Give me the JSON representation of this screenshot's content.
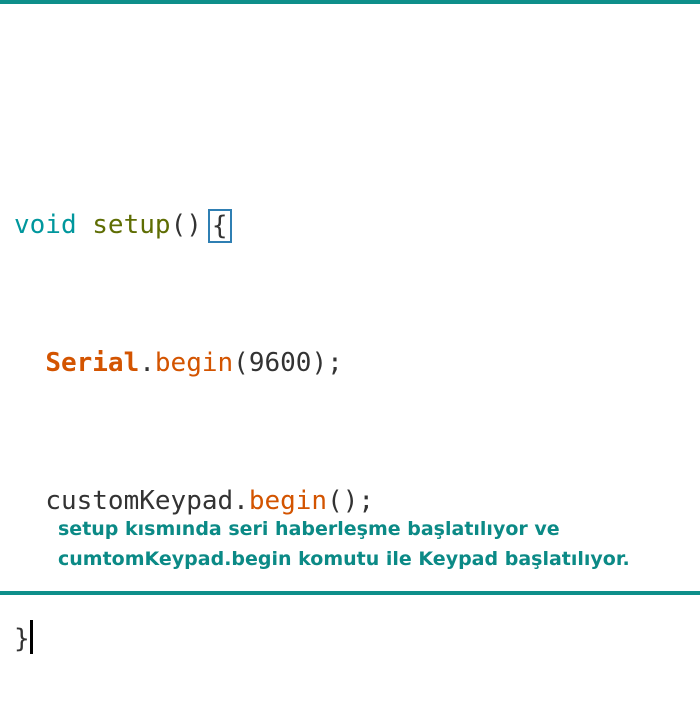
{
  "code": {
    "line1": {
      "type": "void",
      "fn": "setup",
      "parens": "()",
      "brace": "{"
    },
    "line2": {
      "class": "Serial",
      "dot": ".",
      "method": "begin",
      "args": "(9600);"
    },
    "line3": {
      "object": "customKeypad",
      "dot": ".",
      "method": "begin",
      "args": "();"
    },
    "line4": {
      "brace": "}"
    }
  },
  "caption": {
    "line1": "setup kısmında seri haberleşme başlatılıyor ve",
    "line2": "cumtomKeypad.begin komutu ile Keypad başlatılıyor."
  },
  "colors": {
    "accent": "#0e8f8a",
    "keyword_type": "#00979d",
    "function_name": "#5e6d03",
    "builtin_orange": "#d35400",
    "bracket_highlight": "#2f7fb3"
  }
}
